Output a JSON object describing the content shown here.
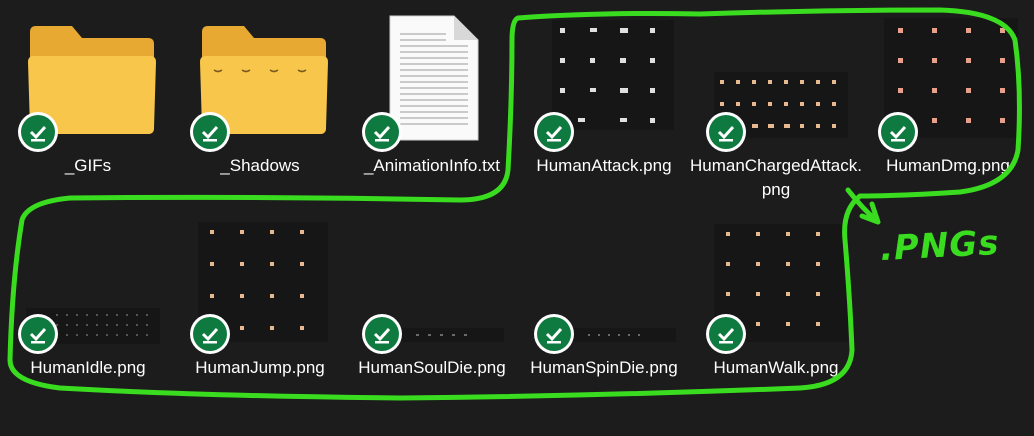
{
  "files": [
    {
      "id": "gifs",
      "label": "_GIFs",
      "kind": "folder"
    },
    {
      "id": "shadows",
      "label": "_Shadows",
      "kind": "folder"
    },
    {
      "id": "animinfo",
      "label": "_AnimationInfo.txt",
      "kind": "text"
    },
    {
      "id": "attack",
      "label": "HumanAttack.png",
      "kind": "png"
    },
    {
      "id": "charged",
      "label": "HumanChargedAttack.png",
      "kind": "png"
    },
    {
      "id": "dmg",
      "label": "HumanDmg.png",
      "kind": "png"
    },
    {
      "id": "idle",
      "label": "HumanIdle.png",
      "kind": "png"
    },
    {
      "id": "jump",
      "label": "HumanJump.png",
      "kind": "png"
    },
    {
      "id": "souldie",
      "label": "HumanSoulDie.png",
      "kind": "png"
    },
    {
      "id": "spindie",
      "label": "HumanSpinDie.png",
      "kind": "png"
    },
    {
      "id": "walk",
      "label": "HumanWalk.png",
      "kind": "png"
    }
  ],
  "annotation": {
    "text": ".PNGs"
  },
  "colors": {
    "background": "#1c1c1c",
    "folder_back": "#e8a933",
    "folder_front": "#f7c64b",
    "sync_badge": "#0e7a3f",
    "annotation": "#3adc1f",
    "label_text": "#ffffff"
  },
  "icons": {
    "sync_badge": "green-check-sync-icon",
    "folder": "folder-icon",
    "text_file": "text-file-icon",
    "png_thumbnail": "sprite-sheet-thumbnail"
  }
}
